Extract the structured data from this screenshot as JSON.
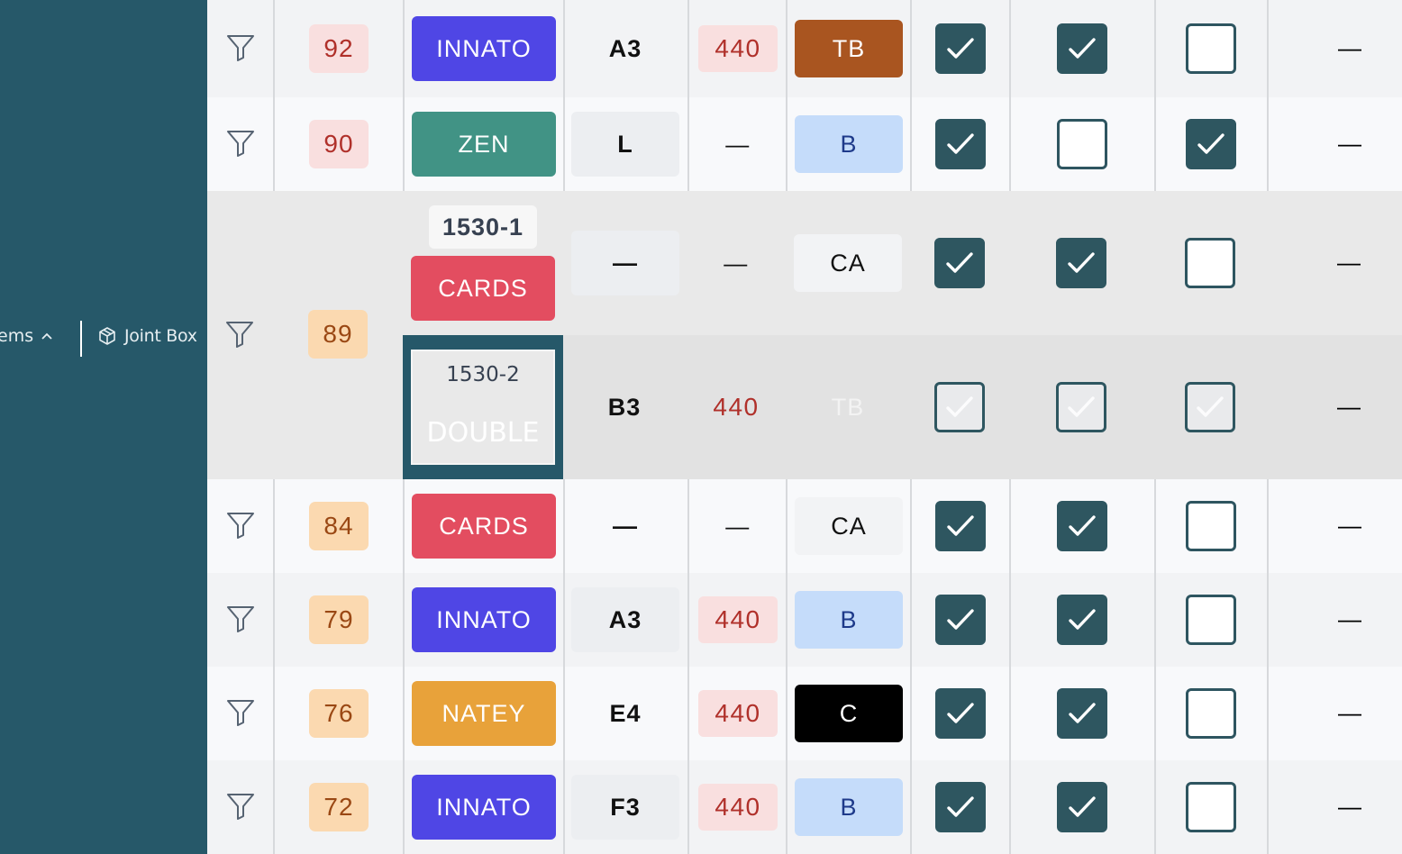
{
  "sidebar": {
    "items_label": "ems",
    "joint_box_label": "Joint Box"
  },
  "colors": {
    "sidebar_bg": "#265869",
    "checkbox_checked": "#2e5660",
    "innato": "#4f46e5",
    "zen": "#419385",
    "cards": "#e34d60",
    "natey": "#e8a23a",
    "tag_tb": "#a95520",
    "tag_b": "#c5dcfa",
    "tag_c": "#000000",
    "num_red_bg": "#f9dfdf",
    "num_orange_bg": "#fbd9b0"
  },
  "rows": [
    {
      "number": "92",
      "number_style": "red",
      "type": "INNATO",
      "position": "A3",
      "position_boxed": false,
      "hz": "440",
      "tag": "TB",
      "tag_style": "tb",
      "checks": [
        true,
        true,
        false
      ],
      "last": "—"
    },
    {
      "number": "90",
      "number_style": "red",
      "type": "ZEN",
      "position": "L",
      "position_boxed": true,
      "hz": "—",
      "tag": "B",
      "tag_style": "b",
      "checks": [
        true,
        false,
        true
      ],
      "last": "—"
    },
    {
      "number": "89",
      "number_style": "orange",
      "sub": [
        {
          "code": "1530-1",
          "type": "CARDS",
          "position": "—",
          "position_boxed": true,
          "hz": "—",
          "tag": "CA",
          "tag_style": "ca",
          "checks": [
            true,
            true,
            false
          ],
          "last": "—"
        },
        {
          "code": "1530-2",
          "type": "DOUBLE",
          "position": "B3",
          "position_boxed": false,
          "hz": "440",
          "tag": "TB",
          "tag_style": "faded",
          "checks": [
            true,
            true,
            true
          ],
          "checks_faded": true,
          "last": "—"
        }
      ]
    },
    {
      "number": "84",
      "number_style": "orange",
      "type": "CARDS",
      "position": "—",
      "position_boxed": false,
      "hz": "—",
      "tag": "CA",
      "tag_style": "ca",
      "checks": [
        true,
        true,
        false
      ],
      "last": "—"
    },
    {
      "number": "79",
      "number_style": "orange",
      "type": "INNATO",
      "position": "A3",
      "position_boxed": true,
      "hz": "440",
      "tag": "B",
      "tag_style": "b",
      "checks": [
        true,
        true,
        false
      ],
      "last": "—"
    },
    {
      "number": "76",
      "number_style": "orange",
      "type": "NATEY",
      "position": "E4",
      "position_boxed": false,
      "hz": "440",
      "tag": "C",
      "tag_style": "c",
      "checks": [
        true,
        true,
        false
      ],
      "last": "—"
    },
    {
      "number": "72",
      "number_style": "orange",
      "type": "INNATO",
      "position": "F3",
      "position_boxed": true,
      "hz": "440",
      "tag": "B",
      "tag_style": "b",
      "checks": [
        true,
        true,
        false
      ],
      "last": "—"
    }
  ]
}
